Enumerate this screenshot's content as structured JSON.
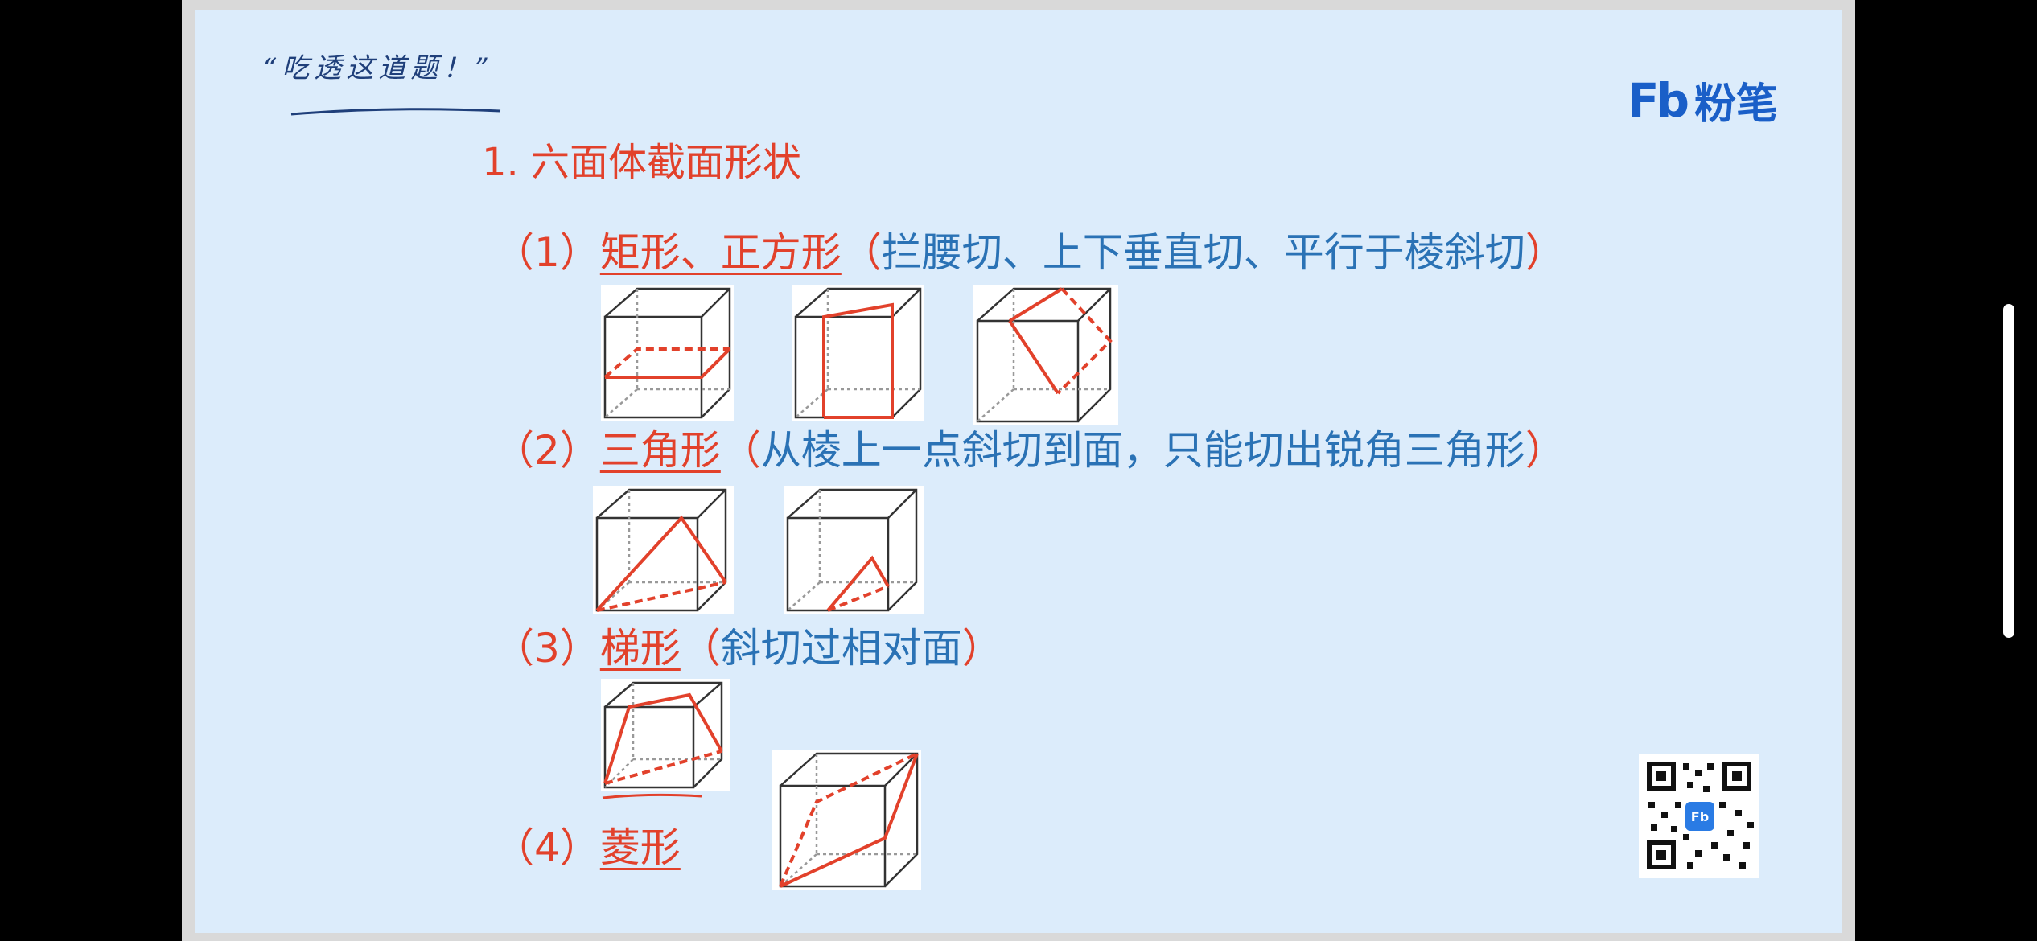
{
  "slogan": "“吃透这道题！”",
  "logo": {
    "mark": "Fb",
    "text": "粉笔"
  },
  "title": "1. 六面体截面形状",
  "rows": [
    {
      "num": "（1）",
      "shape": "矩形、正方形",
      "desc_open": "（",
      "desc": "拦腰切、上下垂直切、平行于棱斜切",
      "desc_close": "）"
    },
    {
      "num": "（2）",
      "shape": "三角形",
      "desc_open": "（",
      "desc": "从棱上一点斜切到面，只能切出锐角三角形",
      "desc_close": "）"
    },
    {
      "num": "（3）",
      "shape": "梯形",
      "desc_open": "（",
      "desc": "斜切过相对面",
      "desc_close": "）"
    },
    {
      "num": "（4）",
      "shape": "菱形"
    }
  ],
  "colors": {
    "accent_red": "#e2412b",
    "text_blue": "#2a72b5",
    "slide_bg": "#dcecfb",
    "logo_blue": "#1a5fc8"
  },
  "icons": {
    "qr": "qr-code-icon",
    "cube": "cube-section-diagram"
  }
}
